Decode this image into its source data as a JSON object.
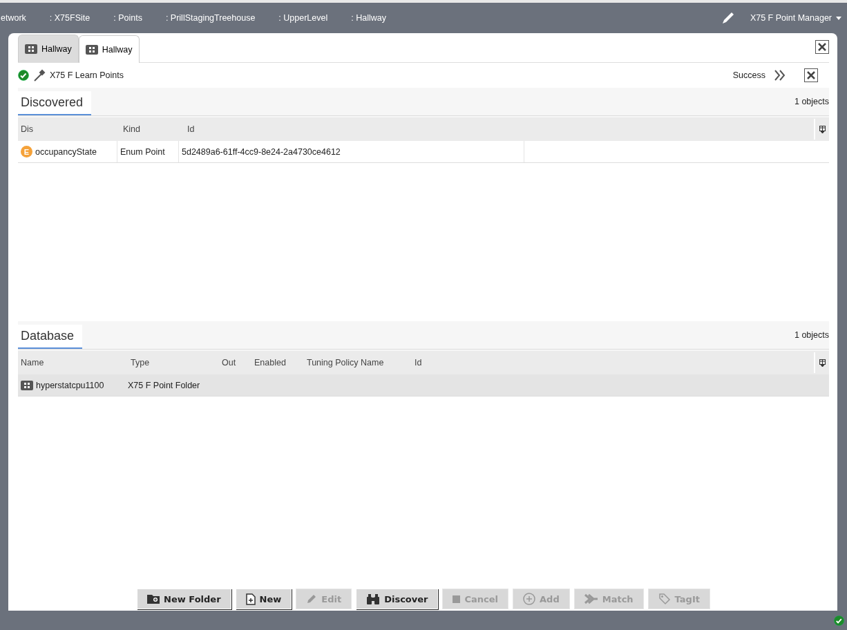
{
  "breadcrumbs": [
    "etwork",
    ": X75FSite",
    ": Points",
    ": PrillStagingTreehouse",
    ": UpperLevel",
    ": Hallway"
  ],
  "view_selector": {
    "label": "X75 F Point Manager"
  },
  "tabs": [
    {
      "label": "Hallway",
      "selected": false
    },
    {
      "label": "Hallway",
      "selected": true
    }
  ],
  "job": {
    "title": "X75 F Learn Points",
    "status": "Success"
  },
  "discovered": {
    "title": "Discovered",
    "count": "1 objects",
    "columns": [
      "Dis",
      "Kind",
      "Id"
    ],
    "rows": [
      {
        "selected": false,
        "kind": "enum",
        "badge": "E",
        "cells": [
          "occupancyState",
          "Enum Point",
          "5d2489a6-61ff-4cc9-8e24-2a4730ce4612"
        ]
      }
    ]
  },
  "database": {
    "title": "Database",
    "count": "1 objects",
    "columns": [
      "Name",
      "Type",
      "Out",
      "Enabled",
      "Tuning Policy Name",
      "Id"
    ],
    "rows": [
      {
        "selected": true,
        "kind": "folder",
        "cells": [
          "hyperstatcpu1100",
          "X75 F Point Folder"
        ]
      }
    ]
  },
  "buttons": [
    {
      "label": "New Folder",
      "kind": "folder",
      "disabled": false
    },
    {
      "label": "New",
      "kind": "file",
      "disabled": false
    },
    {
      "label": "Edit",
      "kind": "pencil",
      "disabled": true
    },
    {
      "label": "Discover",
      "kind": "binoculars",
      "disabled": false
    },
    {
      "label": "Cancel",
      "kind": "stop",
      "disabled": true
    },
    {
      "label": "Add",
      "kind": "plus",
      "disabled": true
    },
    {
      "label": "Match",
      "kind": "merge",
      "disabled": true
    },
    {
      "label": "TagIt",
      "kind": "tag",
      "disabled": true
    }
  ]
}
